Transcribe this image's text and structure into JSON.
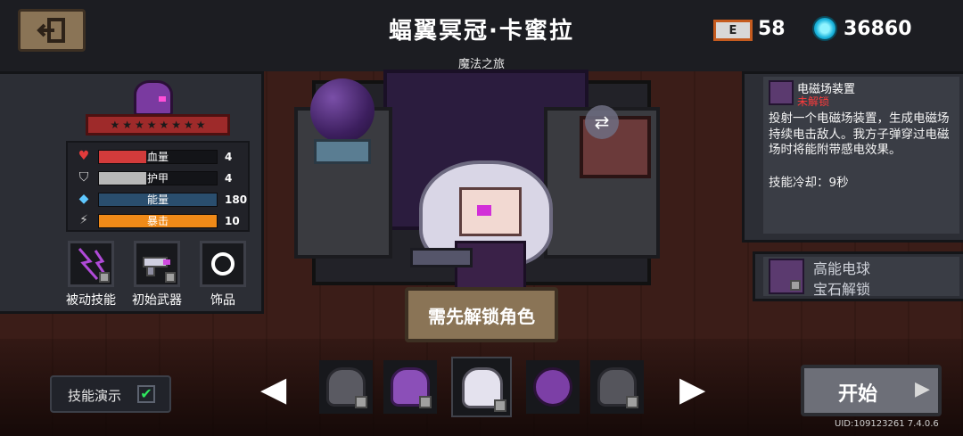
{
  "header": {
    "title": "蝠翼冥冠·卡蜜拉",
    "subtitle": "魔法之旅",
    "energy_badge": "E",
    "energy_value": "58",
    "gem_value": "36860"
  },
  "character": {
    "stars": 8,
    "stats": [
      {
        "label": "血量",
        "value": "4",
        "icon": "heart-icon",
        "color": "#d33b3b",
        "fill": 0.4
      },
      {
        "label": "护甲",
        "value": "4",
        "icon": "shield-icon",
        "color": "#b8b8b8",
        "fill": 0.4
      },
      {
        "label": "能量",
        "value": "180",
        "icon": "diamond-icon",
        "color": "#3e7db6",
        "fill": 0.0
      },
      {
        "label": "暴击",
        "value": "10",
        "icon": "crit-icon",
        "color": "#f08a18",
        "fill": 1.0
      }
    ]
  },
  "slots": {
    "passive_label": "被动技能",
    "weapon_label": "初始武器",
    "accessory_label": "饰品"
  },
  "skill": {
    "name": "电磁场装置",
    "status": "未解锁",
    "description": "投射一个电磁场装置，生成电磁场持续电击敌人。我方子弹穿过电磁场时将能附带感电效果。",
    "cooldown": "技能冷却：9秒"
  },
  "gem_skill": {
    "name": "高能电球",
    "sub": "宝石解锁"
  },
  "unlock_button": "需先解锁角色",
  "demo": {
    "label": "技能演示",
    "check": "✔"
  },
  "arrows": {
    "left": "◀",
    "right": "▶"
  },
  "start_button": "开始",
  "start_arrow": "▶",
  "swap_glyph": "⇄",
  "uid": "UID:109123261 7.4.0.6",
  "colors": {
    "accent": "#8a7456",
    "locked": "#ff3b3b",
    "check": "#2ee65e"
  }
}
